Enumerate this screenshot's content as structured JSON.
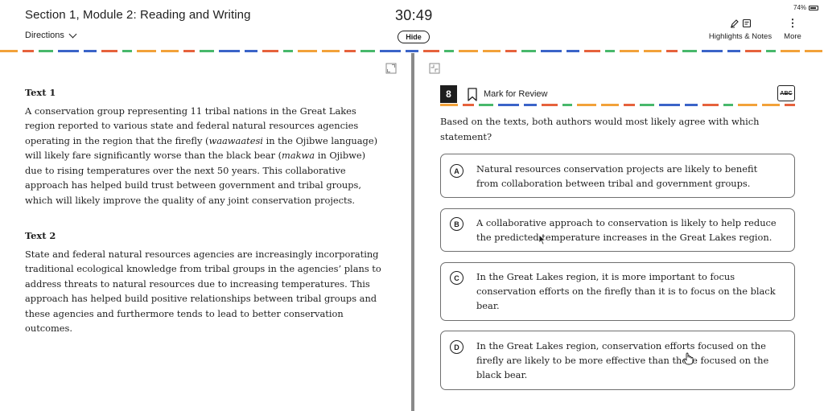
{
  "header": {
    "section_title": "Section 1, Module 2: Reading and Writing",
    "directions_label": "Directions",
    "timer": "30:49",
    "hide_label": "Hide",
    "battery": "74%",
    "highlights_label": "Highlights & Notes",
    "more_label": "More"
  },
  "passages": [
    {
      "heading": "Text 1",
      "parts": [
        {
          "text": "A conservation group representing 11 tribal nations in the Great Lakes region reported to various state and federal natural resources agencies operating in the region that the firefly (",
          "italic": false
        },
        {
          "text": "waawaatesi",
          "italic": true
        },
        {
          "text": " in the Ojibwe language) will likely fare significantly worse than the black bear (",
          "italic": false
        },
        {
          "text": "makwa",
          "italic": true
        },
        {
          "text": " in Ojibwe) due to rising temperatures over the next 50 years. This collaborative approach has helped build trust between government and tribal groups, which will likely improve the quality of any joint conservation projects.",
          "italic": false
        }
      ]
    },
    {
      "heading": "Text 2",
      "parts": [
        {
          "text": "State and federal natural resources agencies are increasingly incorporating traditional ecological knowledge from tribal groups in the agencies’ plans to address threats to natural resources due to increasing temperatures. This approach has helped build positive relationships between tribal groups and these agencies and furthermore tends to lead to better conservation outcomes.",
          "italic": false
        }
      ]
    }
  ],
  "question": {
    "number": "8",
    "mark_for_review_label": "Mark for Review",
    "abc_label": "ABC",
    "prompt": "Based on the texts, both authors would most likely agree with which statement?",
    "options": [
      {
        "letter": "A",
        "text": "Natural resources conservation projects are likely to benefit from collaboration between tribal and government groups."
      },
      {
        "letter": "B",
        "text": "A collaborative approach to conservation is likely to help reduce the predicted temperature increases in the Great Lakes region."
      },
      {
        "letter": "C",
        "text": "In the Great Lakes region, it is more important to focus conservation efforts on the firefly than it is to focus on the black bear."
      },
      {
        "letter": "D",
        "text": "In the Great Lakes region, conservation efforts focused on the firefly are likely to be more effective than those focused on the black bear."
      }
    ]
  },
  "colors": {
    "text": "#1e1e1e",
    "divider": "#8a8a8a",
    "option_border": "#6f6f6f",
    "strip": [
      "#e6623c",
      "#f2a23a",
      "#3b64c8",
      "#48b86b",
      "#e6623c",
      "#3b64c8",
      "#f2a23a",
      "#48b86b"
    ]
  }
}
